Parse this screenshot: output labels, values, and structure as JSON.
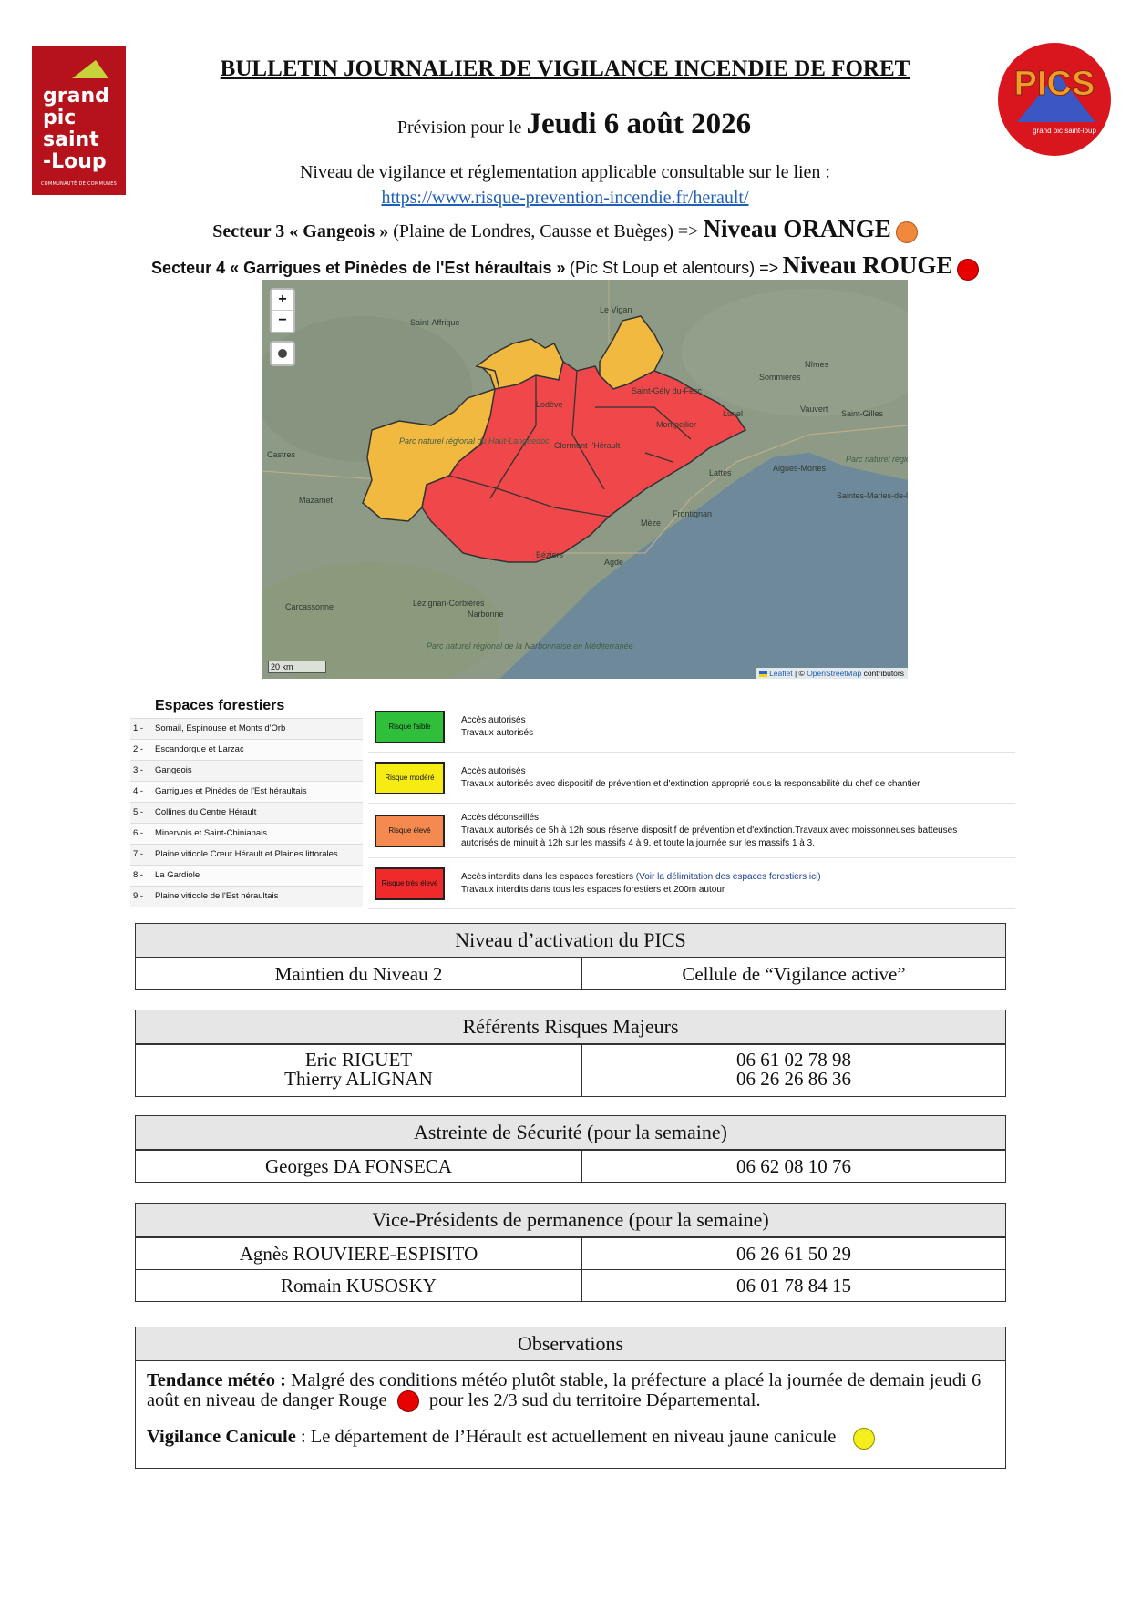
{
  "logo_left": {
    "lines": [
      "grand",
      "pic",
      "saint",
      "-Loup"
    ],
    "subtitle": "COMMUNAUTÉ DE COMMUNES"
  },
  "logo_right": {
    "text": "PICS",
    "small": "grand pic saint-loup"
  },
  "header": {
    "title": "BULLETIN JOURNALIER DE VIGILANCE INCENDIE DE FORET",
    "prevision_prefix": "Prévision pour le",
    "date": "Jeudi 6 août 2026",
    "niveau_text": "Niveau de vigilance et réglementation applicable consultable sur le lien :",
    "link": "https://www.risque-prevention-incendie.fr/herault/"
  },
  "sectors": [
    {
      "label": "Secteur 3 « Gangeois »",
      "detail": "(Plaine de Londres, Causse et Buèges) =>",
      "level": "Niveau ORANGE",
      "color": "#f0893b"
    },
    {
      "label": "Secteur 4 « Garrigues et Pinèdes de l'Est héraultais »",
      "detail": "(Pic St Loup et alentours) =>",
      "level": "Niveau ROUGE",
      "color": "#e60000"
    }
  ],
  "map": {
    "places": [
      "Saint-Affrique",
      "Le Vigan",
      "Nîmes",
      "Sommières",
      "Vauvert",
      "Saint-Gilles",
      "Saint-Gély du-Fesc",
      "Montpellier",
      "Lunel",
      "Castres",
      "Mazamet",
      "Clermont-l'Hérault",
      "Lodève",
      "Aigues-Mortes",
      "Lattes",
      "Mèze",
      "Frontignan",
      "Béziers",
      "Agde",
      "Carcassonne",
      "Lézignan-Corbières",
      "Narbonne",
      "Parc naturel régional du Haut-Languedoc",
      "Parc naturel régional de la Narbonnaise en Méditerranée",
      "Parc naturel régional de Camargue",
      "Saintes-Maries-de-la-Mer"
    ],
    "zoom_in": "+",
    "zoom_out": "−",
    "scale": "20 km",
    "attribution_leaflet": "Leaflet",
    "attribution_sep": "| ©",
    "attribution_osm": "OpenStreetMap",
    "attribution_suffix": "contributors",
    "colors": {
      "orange": "#f2b940",
      "red": "#f0484a",
      "sea": "#6e8a9a",
      "land": "#8c9a86"
    }
  },
  "legend": {
    "title": "Espaces forestiers",
    "items": [
      {
        "num": "1 -",
        "label": "Somail, Espinouse et Monts d'Orb"
      },
      {
        "num": "2 -",
        "label": "Escandorgue et Larzac"
      },
      {
        "num": "3 -",
        "label": "Gangeois"
      },
      {
        "num": "4 -",
        "label": "Garrigues et Pinèdes de l'Est héraultais"
      },
      {
        "num": "5 -",
        "label": "Collines du Centre Hérault"
      },
      {
        "num": "6 -",
        "label": "Minervois et Saint-Chinianais"
      },
      {
        "num": "7 -",
        "label": "Plaine viticole Cœur Hérault et Plaines littorales"
      },
      {
        "num": "8 -",
        "label": "La Gardiole"
      },
      {
        "num": "9 -",
        "label": "Plaine viticole de l'Est héraultais"
      }
    ],
    "risks": [
      {
        "box": "Risque faible",
        "color": "#2fbf3a",
        "line1": "Accès autorisés",
        "line2": "Travaux autorisés",
        "line3": "",
        "link": ""
      },
      {
        "box": "Risque modéré",
        "color": "#f6ec13",
        "line1": "Accès autorisés",
        "line2": "Travaux autorisés avec dispositif de prévention et d'extinction approprié sous la responsabilité du chef de chantier",
        "line3": "",
        "link": ""
      },
      {
        "box": "Risque élevé",
        "color": "#f48a4f",
        "line1": "Accès déconseillés",
        "line2": "Travaux autorisés de 5h à 12h sous réserve dispositif de prévention et d'extinction.Travaux avec moissonneuses batteuses",
        "line3": "autorisés de minuit à 12h sur les massifs 4 à 9, et toute la journée sur les massifs 1 à 3.",
        "link": ""
      },
      {
        "box": "Risque très élevé",
        "color": "#ef2a2a",
        "line1": "Accès interdits dans les espaces forestiers",
        "line2": "Travaux interdits dans tous les espaces forestiers et 200m autour",
        "line3": "",
        "link": "(Voir la délimitation des espaces forestiers ici)"
      }
    ]
  },
  "pics_table": {
    "header": "Niveau d’activation du PICS",
    "left": "Maintien du Niveau 2",
    "right": "Cellule de “Vigilance active”"
  },
  "referents_table": {
    "header": "Référents Risques Majeurs",
    "names": [
      "Eric RIGUET",
      "Thierry ALIGNAN"
    ],
    "phones": [
      "06 61 02 78 98",
      "06 26 26 86 36"
    ]
  },
  "astreinte_table": {
    "header": "Astreinte de Sécurité (pour la semaine)",
    "name": "Georges DA FONSECA",
    "phone": "06 62 08 10 76"
  },
  "vp_table": {
    "header": "Vice-Présidents de permanence (pour la semaine)",
    "rows": [
      {
        "name": "Agnès ROUVIERE-ESPISITO",
        "phone": "06 26 61 50 29"
      },
      {
        "name": "Romain KUSOSKY",
        "phone": "06 01 78 84 15"
      }
    ]
  },
  "observations": {
    "header": "Observations",
    "meteo_label": "Tendance météo :",
    "meteo_text_1": "Malgré des conditions météo plutôt stable, la préfecture a placé la journée de demain jeudi 6 août en niveau de danger Rouge",
    "meteo_text_2": "pour les 2/3 sud du territoire Départemental.",
    "meteo_dot_color": "#e60000",
    "canicule_label": "Vigilance Canicule",
    "canicule_text": ": Le département de l’Hérault est actuellement en niveau jaune canicule",
    "canicule_dot_color": "#f3ee1c"
  }
}
